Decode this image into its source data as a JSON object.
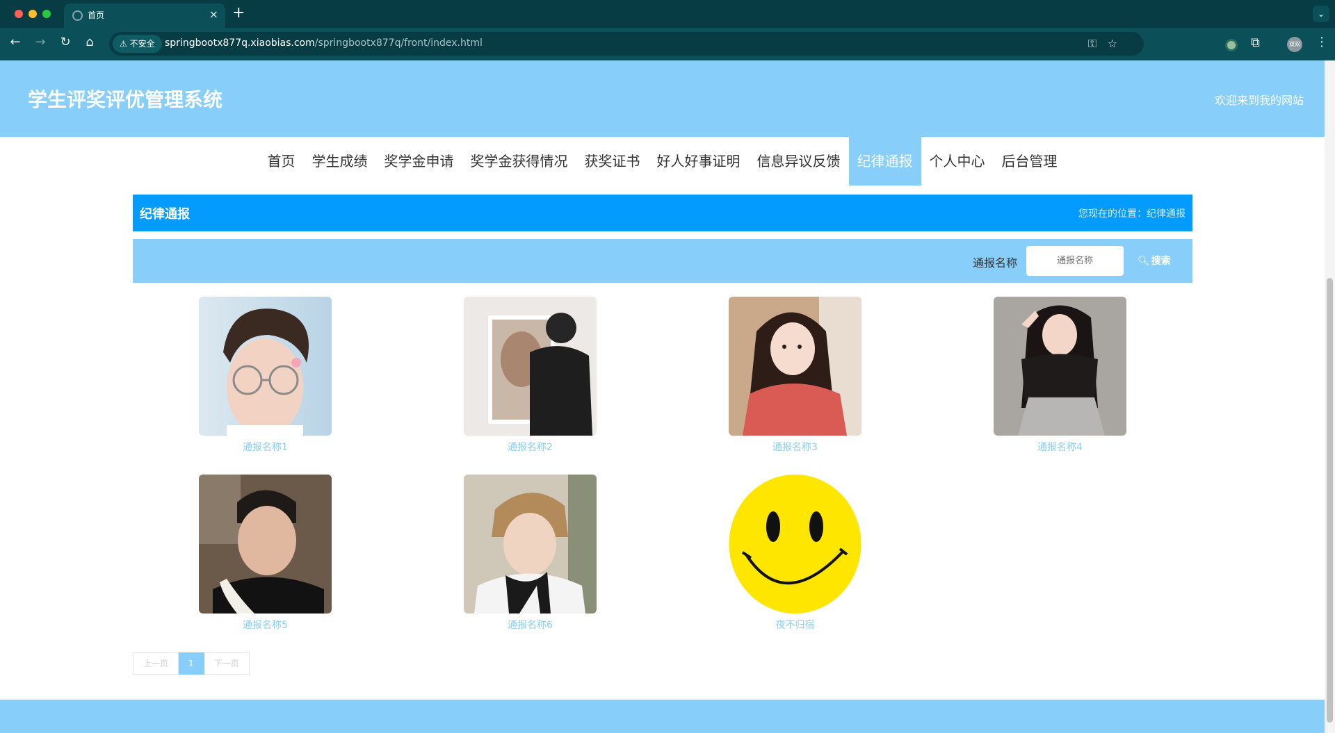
{
  "browser": {
    "tab_title": "首页",
    "tab_close": "×",
    "new_tab": "+",
    "tab_menu": "⌄",
    "insecure_label": "⚠ 不安全",
    "url_host": "springbootx877q.xiaobias.com",
    "url_path": "/springbootx877q/front/index.html",
    "profile_label": "双双"
  },
  "header": {
    "title": "学生评奖评优管理系统",
    "welcome": "欢迎来到我的网站"
  },
  "nav": {
    "items": [
      {
        "label": "首页"
      },
      {
        "label": "学生成绩"
      },
      {
        "label": "奖学金申请"
      },
      {
        "label": "奖学金获得情况"
      },
      {
        "label": "获奖证书"
      },
      {
        "label": "好人好事证明"
      },
      {
        "label": "信息异议反馈"
      },
      {
        "label": "纪律通报"
      },
      {
        "label": "个人中心"
      },
      {
        "label": "后台管理"
      }
    ],
    "active_index": 7
  },
  "breadcrumb": {
    "title": "纪律通报",
    "position": "您现在的位置：纪律通报"
  },
  "search": {
    "label": "通报名称",
    "placeholder": "通报名称",
    "button": "搜索"
  },
  "cards": [
    {
      "name": "通报名称1",
      "image": "young man with glasses and earring"
    },
    {
      "name": "通报名称2",
      "image": "person facing a framed artwork"
    },
    {
      "name": "通报名称3",
      "image": "girl in red top on stairs"
    },
    {
      "name": "通报名称4",
      "image": "girl posing with peace sign"
    },
    {
      "name": "通报名称5",
      "image": "young man with towel in gym"
    },
    {
      "name": "通报名称6",
      "image": "young man in white jacket"
    },
    {
      "name": "夜不归宿",
      "image": "yellow smiley face"
    }
  ],
  "pagination": {
    "prev": "上一页",
    "current": "1",
    "next": "下一页"
  },
  "colors": {
    "primary": "#87cefa",
    "breadcrumb_bar": "#039bfe",
    "browser_chrome": "#0b4f58"
  }
}
